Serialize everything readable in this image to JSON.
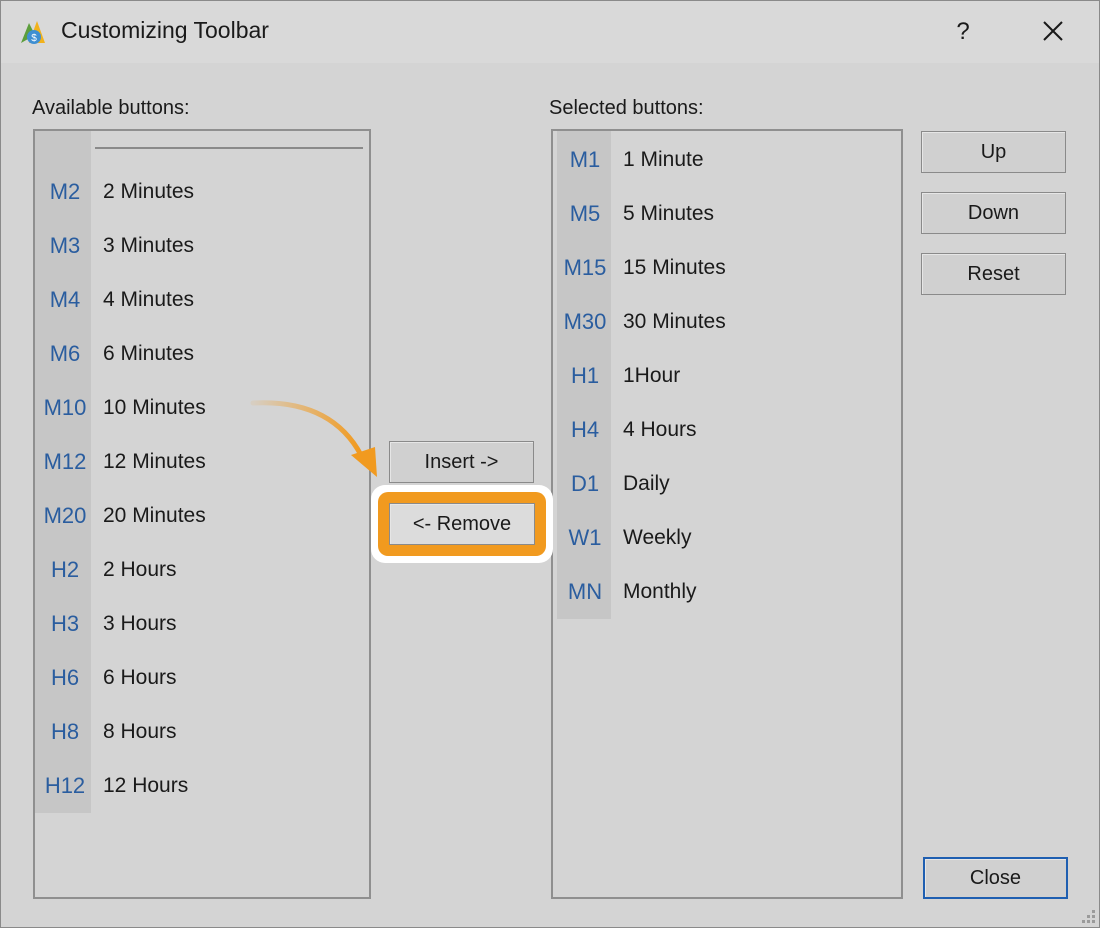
{
  "window": {
    "title": "Customizing Toolbar",
    "help": "?",
    "close_icon": "close-icon"
  },
  "available": {
    "label": "Available buttons:",
    "items": [
      {
        "code": "M2",
        "name": "2 Minutes"
      },
      {
        "code": "M3",
        "name": "3 Minutes"
      },
      {
        "code": "M4",
        "name": "4 Minutes"
      },
      {
        "code": "M6",
        "name": "6 Minutes"
      },
      {
        "code": "M10",
        "name": "10 Minutes"
      },
      {
        "code": "M12",
        "name": "12 Minutes"
      },
      {
        "code": "M20",
        "name": "20 Minutes"
      },
      {
        "code": "H2",
        "name": "2 Hours"
      },
      {
        "code": "H3",
        "name": "3 Hours"
      },
      {
        "code": "H6",
        "name": "6 Hours"
      },
      {
        "code": "H8",
        "name": "8 Hours"
      },
      {
        "code": "H12",
        "name": "12 Hours"
      }
    ]
  },
  "selected": {
    "label": "Selected buttons:",
    "items": [
      {
        "code": "M1",
        "name": "1 Minute"
      },
      {
        "code": "M5",
        "name": "5 Minutes"
      },
      {
        "code": "M15",
        "name": "15 Minutes"
      },
      {
        "code": "M30",
        "name": "30 Minutes"
      },
      {
        "code": "H1",
        "name": "1Hour"
      },
      {
        "code": "H4",
        "name": "4 Hours"
      },
      {
        "code": "D1",
        "name": "Daily"
      },
      {
        "code": "W1",
        "name": "Weekly"
      },
      {
        "code": "MN",
        "name": "Monthly"
      }
    ]
  },
  "buttons": {
    "insert": "Insert ->",
    "remove": "<- Remove",
    "up": "Up",
    "down": "Down",
    "reset": "Reset",
    "close": "Close"
  },
  "colors": {
    "code_text": "#2a5d9f",
    "highlight": "#f19a1f",
    "default_button_border": "#1f5fb1"
  }
}
